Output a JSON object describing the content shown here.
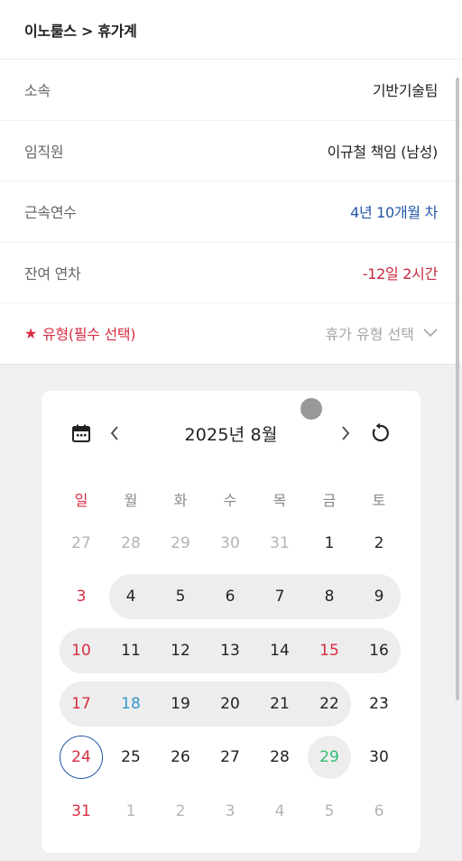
{
  "header": {
    "breadcrumb": "이노룰스 > 휴가계"
  },
  "info": {
    "dept": {
      "label": "소속",
      "value": "기반기술팀"
    },
    "employee": {
      "label": "임직원",
      "value": "이규철 책임 (남성)"
    },
    "tenure": {
      "label": "근속연수",
      "value": "4년 10개월 차"
    },
    "remaining": {
      "label": "잔여 연차",
      "value": "-12일 2시간"
    },
    "type": {
      "label": "유형(필수 선택)",
      "star": "★",
      "placeholder": "휴가 유형 선택"
    }
  },
  "calendar": {
    "month_label": "2025년 8월",
    "weekdays": [
      "일",
      "월",
      "화",
      "수",
      "목",
      "금",
      "토"
    ],
    "weeks": [
      [
        "27",
        "28",
        "29",
        "30",
        "31",
        "1",
        "2"
      ],
      [
        "3",
        "4",
        "5",
        "6",
        "7",
        "8",
        "9"
      ],
      [
        "10",
        "11",
        "12",
        "13",
        "14",
        "15",
        "16"
      ],
      [
        "17",
        "18",
        "19",
        "20",
        "21",
        "22",
        "23"
      ],
      [
        "24",
        "25",
        "26",
        "27",
        "28",
        "29",
        "30"
      ],
      [
        "31",
        "1",
        "2",
        "3",
        "4",
        "5",
        "6"
      ]
    ]
  },
  "colors": {
    "accent_red": "#d92d43",
    "accent_blue": "#2456a8",
    "holiday_blue": "#3a97cc",
    "highlight_green": "#2fbf71",
    "range_bg": "#ededee"
  },
  "icons": {
    "calendar": "calendar-icon",
    "prev": "chevron-left-icon",
    "next": "chevron-right-icon",
    "reset": "refresh-icon",
    "dropdown": "chevron-down-icon"
  }
}
